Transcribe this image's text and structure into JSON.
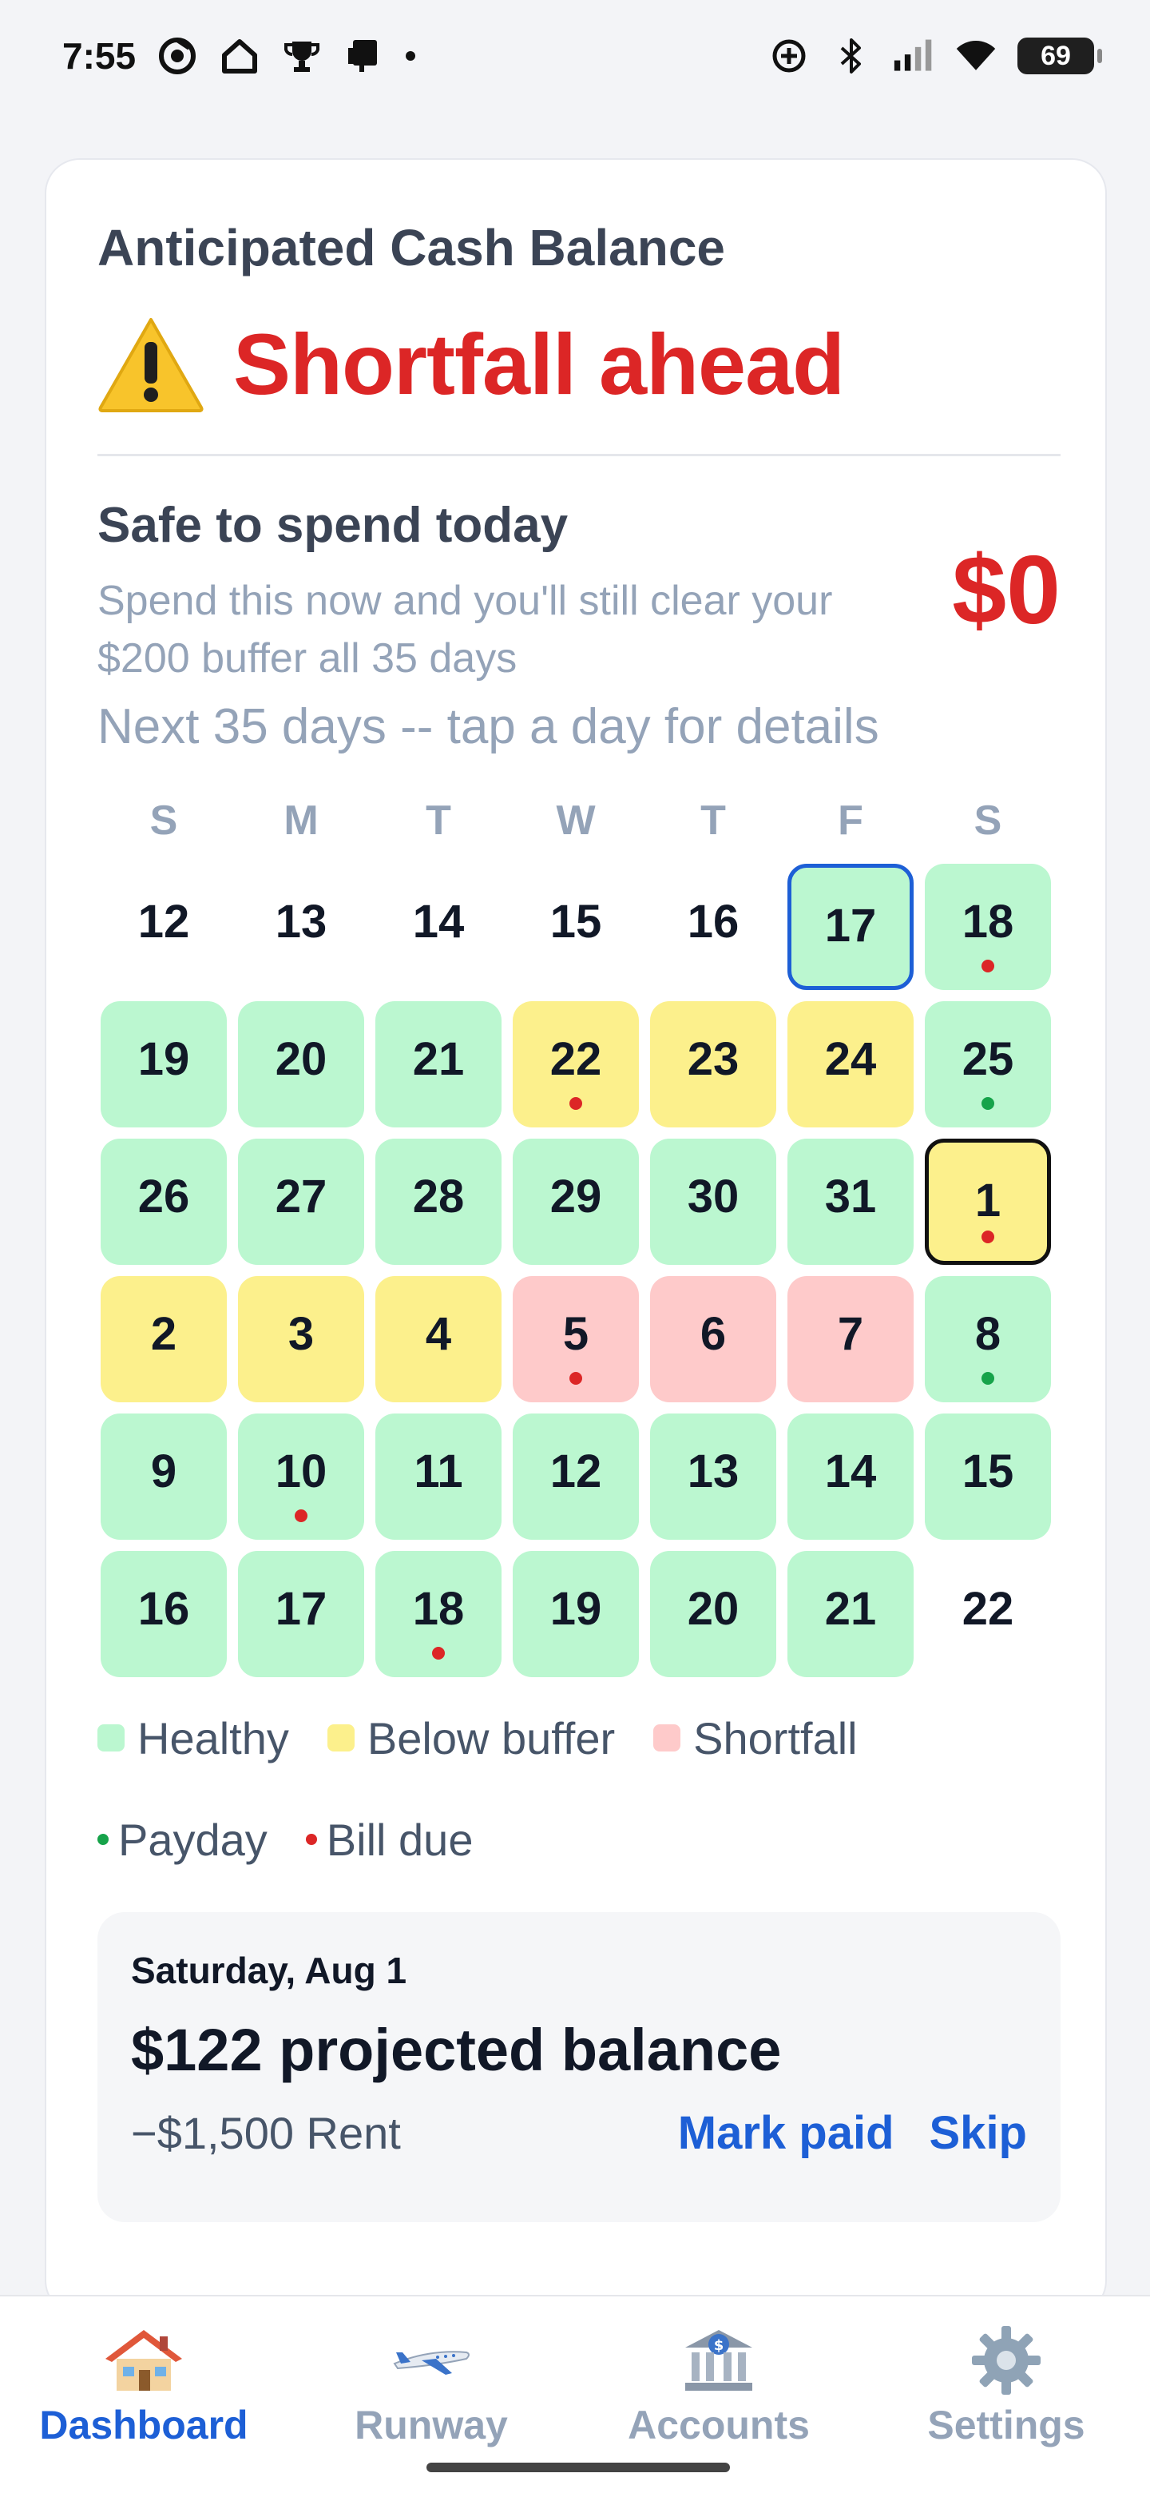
{
  "status_bar": {
    "time": "7:55",
    "battery": "69",
    "left_icons": [
      "chrome-like-icon",
      "home-outline-icon",
      "trophy-icon",
      "device-icon"
    ],
    "right_icons": [
      "add-circle-icon",
      "bluetooth-icon",
      "signal-icon",
      "wifi-icon"
    ]
  },
  "card": {
    "title": "Anticipated Cash Balance",
    "headline": "Shortfall ahead",
    "safe_title": "Safe to spend today",
    "safe_desc": "Spend this now and you'll still clear your $200 buffer all 35 days",
    "safe_amount": "$0",
    "next_label": "Next 35 days -- tap a day for details"
  },
  "calendar": {
    "weekdays": [
      "S",
      "M",
      "T",
      "W",
      "T",
      "F",
      "S"
    ],
    "days": [
      {
        "n": "12",
        "s": "none"
      },
      {
        "n": "13",
        "s": "none"
      },
      {
        "n": "14",
        "s": "none"
      },
      {
        "n": "15",
        "s": "none"
      },
      {
        "n": "16",
        "s": "none"
      },
      {
        "n": "17",
        "s": "healthy",
        "flag": "today"
      },
      {
        "n": "18",
        "s": "healthy",
        "m": "bill"
      },
      {
        "n": "19",
        "s": "healthy"
      },
      {
        "n": "20",
        "s": "healthy"
      },
      {
        "n": "21",
        "s": "healthy"
      },
      {
        "n": "22",
        "s": "below",
        "m": "bill"
      },
      {
        "n": "23",
        "s": "below"
      },
      {
        "n": "24",
        "s": "below"
      },
      {
        "n": "25",
        "s": "healthy",
        "m": "payday"
      },
      {
        "n": "26",
        "s": "healthy"
      },
      {
        "n": "27",
        "s": "healthy"
      },
      {
        "n": "28",
        "s": "healthy"
      },
      {
        "n": "29",
        "s": "healthy"
      },
      {
        "n": "30",
        "s": "healthy"
      },
      {
        "n": "31",
        "s": "healthy"
      },
      {
        "n": "1",
        "s": "below",
        "m": "bill",
        "flag": "selected"
      },
      {
        "n": "2",
        "s": "below"
      },
      {
        "n": "3",
        "s": "below"
      },
      {
        "n": "4",
        "s": "below"
      },
      {
        "n": "5",
        "s": "shortfall",
        "m": "bill"
      },
      {
        "n": "6",
        "s": "shortfall"
      },
      {
        "n": "7",
        "s": "shortfall"
      },
      {
        "n": "8",
        "s": "healthy",
        "m": "payday"
      },
      {
        "n": "9",
        "s": "healthy"
      },
      {
        "n": "10",
        "s": "healthy",
        "m": "bill"
      },
      {
        "n": "11",
        "s": "healthy"
      },
      {
        "n": "12",
        "s": "healthy"
      },
      {
        "n": "13",
        "s": "healthy"
      },
      {
        "n": "14",
        "s": "healthy"
      },
      {
        "n": "15",
        "s": "healthy"
      },
      {
        "n": "16",
        "s": "healthy"
      },
      {
        "n": "17",
        "s": "healthy"
      },
      {
        "n": "18",
        "s": "healthy",
        "m": "bill"
      },
      {
        "n": "19",
        "s": "healthy"
      },
      {
        "n": "20",
        "s": "healthy"
      },
      {
        "n": "21",
        "s": "healthy"
      },
      {
        "n": "22",
        "s": "none"
      }
    ]
  },
  "legend": {
    "healthy": "Healthy",
    "below": "Below buffer",
    "shortfall": "Shortfall",
    "payday": "Payday",
    "bill": "Bill due"
  },
  "detail": {
    "date": "Saturday, Aug 1",
    "balance": "$122 projected balance",
    "bill": "−$1,500 Rent",
    "mark_paid": "Mark paid",
    "skip": "Skip"
  },
  "nav": {
    "dashboard": "Dashboard",
    "runway": "Runway",
    "accounts": "Accounts",
    "settings": "Settings"
  },
  "colors": {
    "healthy": "#bbf7d0",
    "below": "#fcf08c",
    "shortfall": "#fecaca",
    "alert": "#dc2626",
    "accent": "#1d5fd6"
  }
}
